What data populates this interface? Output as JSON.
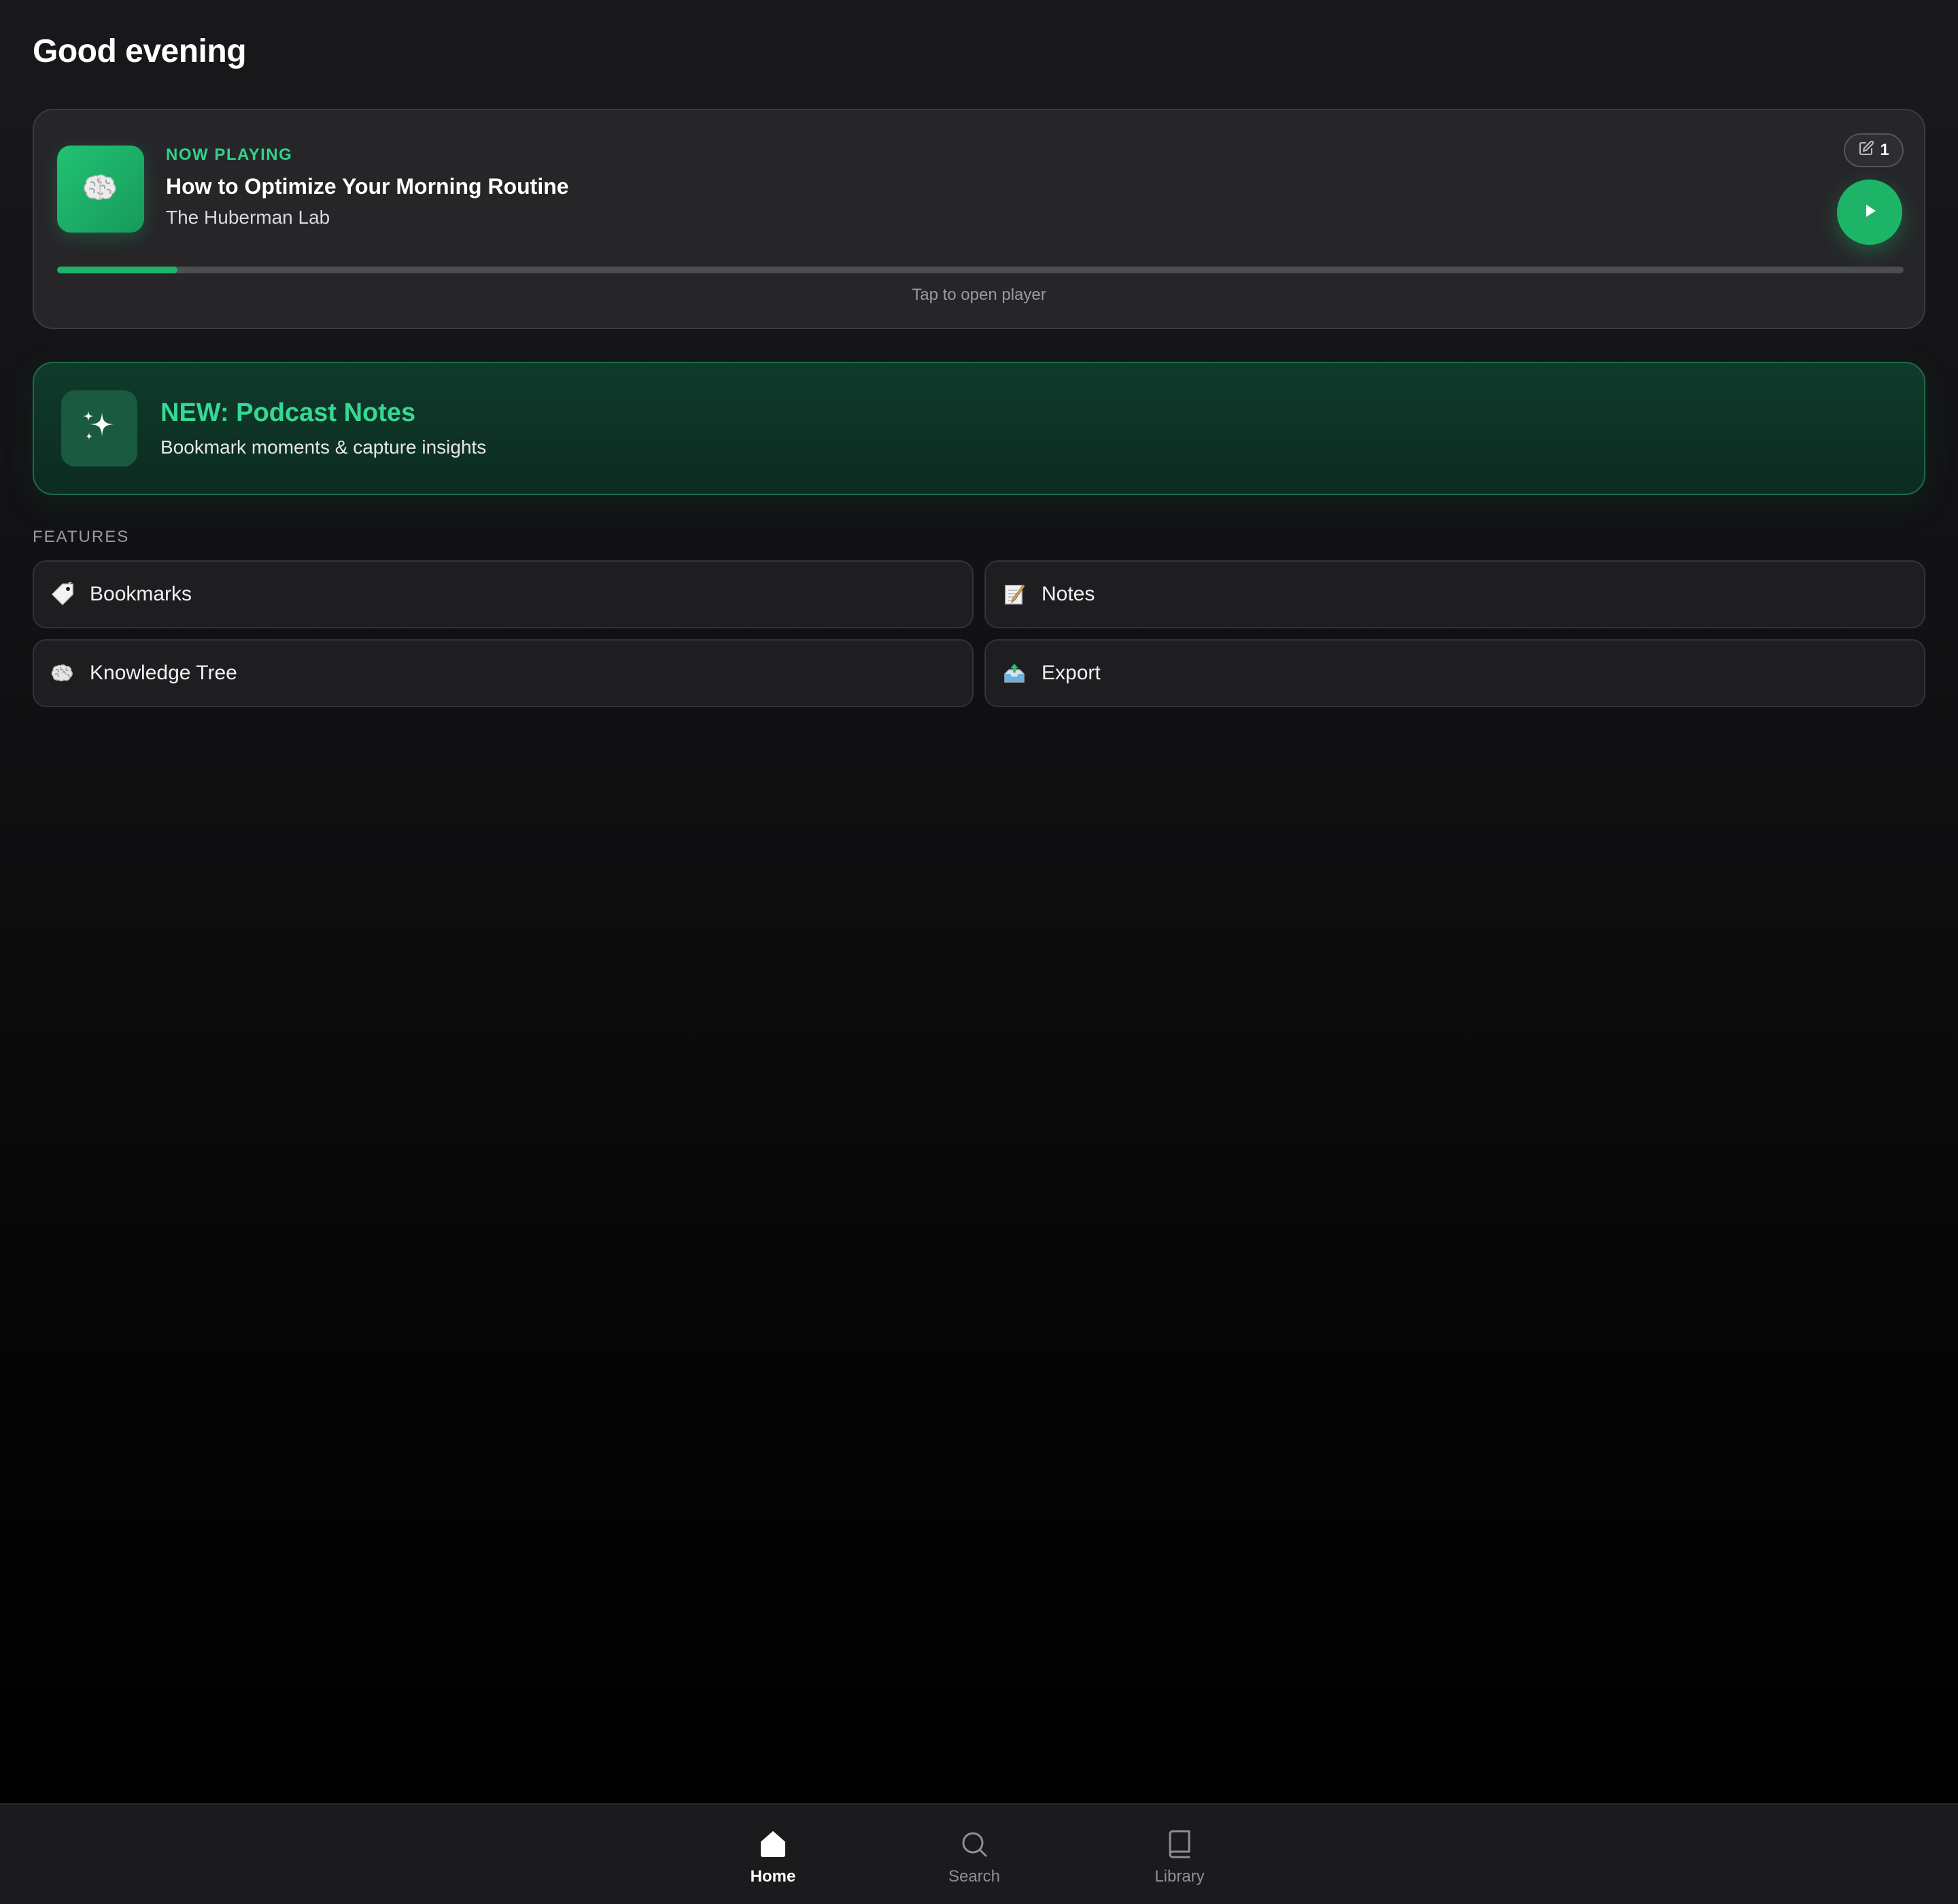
{
  "greeting": "Good evening",
  "now_playing": {
    "label": "NOW PLAYING",
    "episode_title": "How to Optimize Your Morning Routine",
    "podcast_name": "The Huberman Lab",
    "notes_count": "1",
    "progress_percent": 6.5,
    "hint": "Tap to open player",
    "artwork_icon": "brain-icon",
    "accent_color": "#1db468"
  },
  "promo": {
    "title": "NEW: Podcast Notes",
    "subtitle": "Bookmark moments & capture insights",
    "icon": "sparkles-icon"
  },
  "features": {
    "section_label": "FEATURES",
    "items": [
      {
        "label": "Bookmarks",
        "icon": "bookmark-tag-icon"
      },
      {
        "label": "Notes",
        "icon": "memo-icon"
      },
      {
        "label": "Knowledge Tree",
        "icon": "brain-icon"
      },
      {
        "label": "Export",
        "icon": "outbox-tray-icon"
      }
    ]
  },
  "tabbar": {
    "active": "home",
    "tabs": [
      {
        "id": "home",
        "label": "Home",
        "icon": "home-icon"
      },
      {
        "id": "search",
        "label": "Search",
        "icon": "search-icon"
      },
      {
        "id": "library",
        "label": "Library",
        "icon": "book-icon"
      }
    ]
  }
}
